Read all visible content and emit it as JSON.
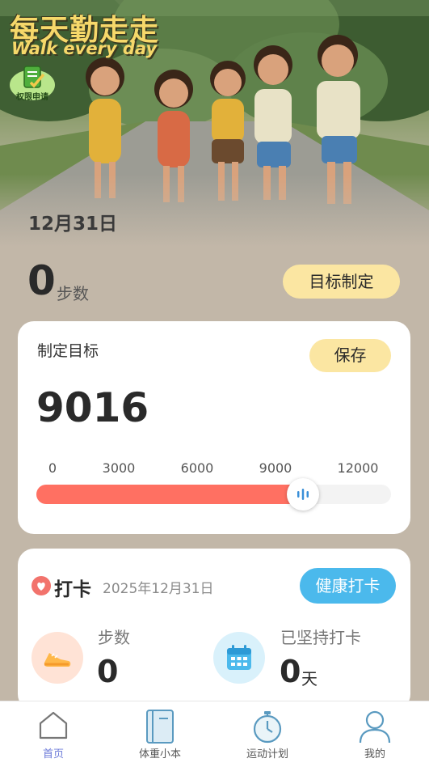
{
  "hero": {
    "title": "每天勤走走",
    "subtitle": "Walk every day",
    "permission_badge": "权限申请",
    "date": "12月31日"
  },
  "today": {
    "steps": "0",
    "steps_unit": "步数",
    "goal_button": "目标制定"
  },
  "goal_card": {
    "title": "制定目标",
    "save_label": "保存",
    "goal_value": "9016",
    "ticks": [
      "0",
      "3000",
      "6000",
      "9000",
      "12000"
    ],
    "slider": {
      "min": 0,
      "max": 12000,
      "value": 9016,
      "fill_color": "#ff7062"
    }
  },
  "checkin_card": {
    "title": "打卡",
    "date": "2025年12月31日",
    "health_button": "健康打卡",
    "steps_label": "步数",
    "steps_value": "0",
    "days_label": "已坚持打卡",
    "days_value": "0",
    "days_unit": "天"
  },
  "tabbar": {
    "items": [
      {
        "label": "首页",
        "icon": "home-icon",
        "active": true
      },
      {
        "label": "体重小本",
        "icon": "notebook-icon",
        "active": false
      },
      {
        "label": "运动计划",
        "icon": "stopwatch-icon",
        "active": false
      },
      {
        "label": "我的",
        "icon": "user-icon",
        "active": false
      }
    ]
  },
  "colors": {
    "accent_yellow": "#fbe6a2",
    "accent_blue": "#4bb9ec",
    "slider_red": "#ff7062",
    "active_tab": "#6a78d8",
    "background": "#c2b7a8"
  }
}
